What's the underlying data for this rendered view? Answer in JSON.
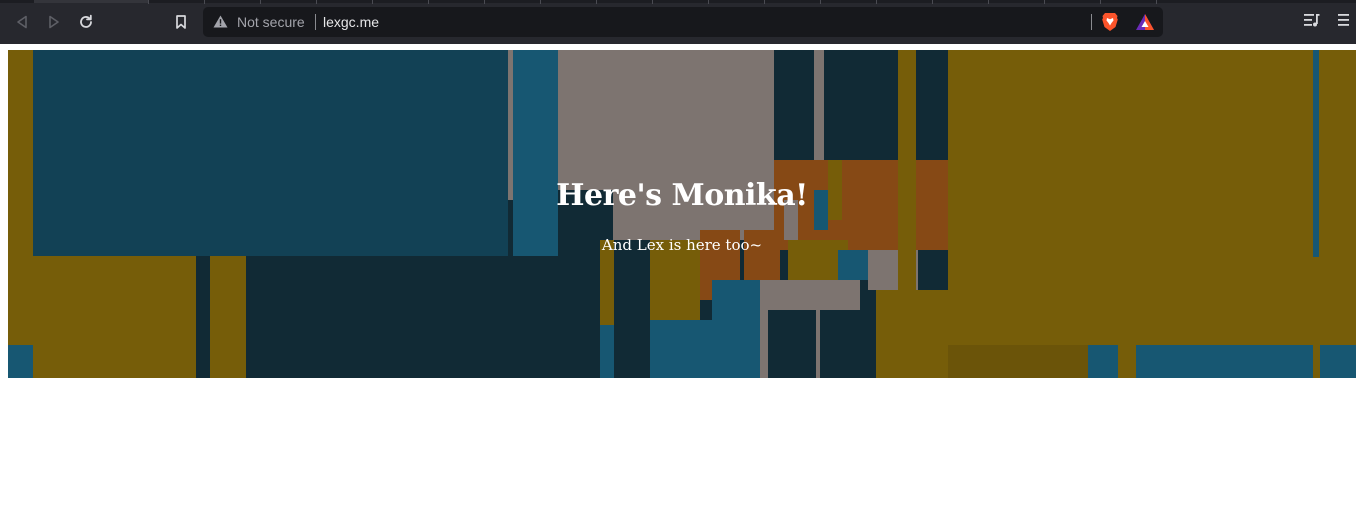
{
  "browser": {
    "security_label": "Not secure",
    "url": "lexgc.me",
    "icons": {
      "back": "back-arrow-icon",
      "forward": "forward-arrow-icon",
      "reload": "reload-icon",
      "bookmark": "bookmark-icon",
      "warning": "warning-triangle-icon",
      "shields": "brave-shields-icon",
      "rewards": "brave-rewards-icon",
      "playlist": "playlist-icon",
      "menu": "hamburger-menu-icon"
    },
    "colors": {
      "toolbar": "#27282e",
      "omnibox": "#17181c",
      "brave_orange": "#fb542b"
    }
  },
  "page": {
    "hero": {
      "title": "Here's Monika!",
      "subtitle": "And Lex is here too~",
      "palette": [
        "#154a61",
        "#1b6482",
        "#8f8580",
        "#876a0b",
        "#995418",
        "#14303d"
      ]
    }
  }
}
